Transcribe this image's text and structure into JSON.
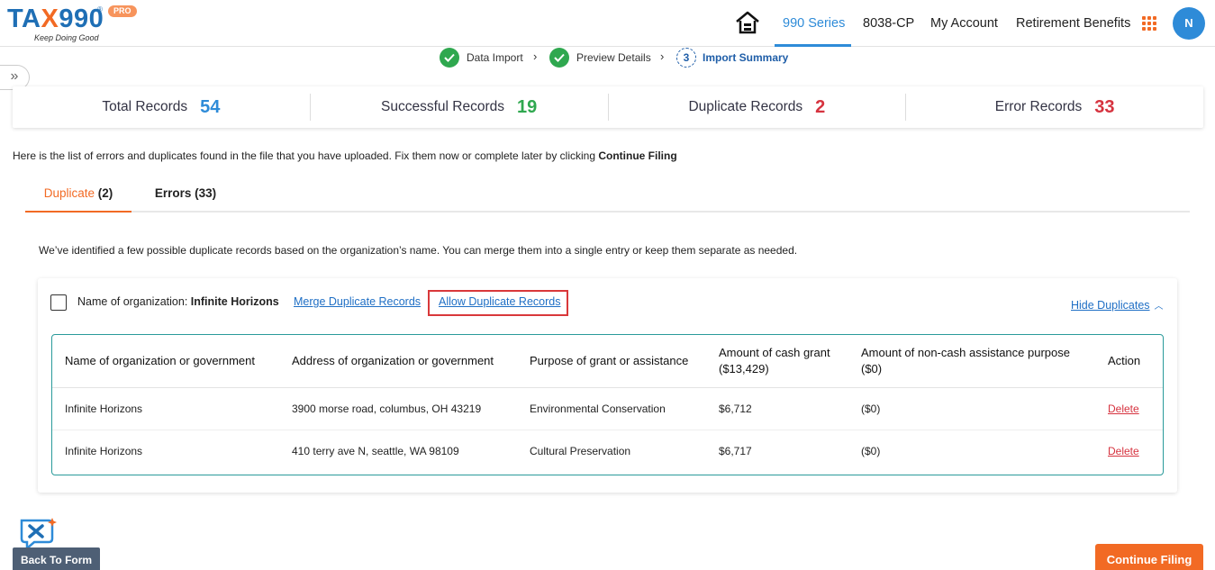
{
  "header": {
    "logo_tax": "TA",
    "logo_x": "X",
    "logo_num": "990",
    "logo_reg": "®",
    "logo_pro": "PRO",
    "logo_tagline": "Keep Doing Good",
    "nav": [
      {
        "label": "990 Series",
        "active": true
      },
      {
        "label": "8038-CP",
        "active": false
      },
      {
        "label": "My Account",
        "active": false
      },
      {
        "label": "Retirement Benefits",
        "active": false
      }
    ],
    "avatar_initial": "N",
    "accent_color": "#2e8bd8",
    "brand_orange": "#f26a24"
  },
  "stepper": {
    "steps": [
      {
        "label": "Data Import",
        "state": "done"
      },
      {
        "label": "Preview Details",
        "state": "done"
      },
      {
        "label": "Import Summary",
        "state": "current",
        "number": "3"
      }
    ]
  },
  "stats": [
    {
      "label": "Total Records",
      "value": "54",
      "color": "#2e8bd8"
    },
    {
      "label": "Successful Records",
      "value": "19",
      "color": "#2fa84f"
    },
    {
      "label": "Duplicate Records",
      "value": "2",
      "color": "#d6333f"
    },
    {
      "label": "Error Records",
      "value": "33",
      "color": "#d6333f"
    }
  ],
  "intro": {
    "text": "Here is the list of errors and duplicates found in the file that you have uploaded. Fix them now or complete later by clicking ",
    "bold": "Continue Filing"
  },
  "tabs": [
    {
      "label": "Duplicate",
      "count": "(2)",
      "active": true
    },
    {
      "label": "Errors (33)",
      "active": false
    }
  ],
  "duplicate_message": "We’ve identified a few possible duplicate records based on the organization’s name. You can merge them into a single entry or keep them separate as needed.",
  "group": {
    "org_label": "Name of organization:",
    "org_name": "Infinite Horizons",
    "merge_link": "Merge Duplicate Records",
    "allow_link": "Allow Duplicate Records",
    "hide_link": "Hide Duplicates",
    "columns": [
      "Name of organization or government",
      "Address of organization or government",
      "Purpose of grant or assistance",
      "Amount of cash grant",
      "Amount of non-cash assistance purpose",
      "Action"
    ],
    "column_subs": {
      "cash": "($13,429)",
      "noncash": "($0)"
    },
    "rows": [
      {
        "name": "Infinite Horizons",
        "address": "3900 morse road, columbus, OH 43219",
        "purpose": "Environmental Conservation",
        "cash": "$6,712",
        "noncash": "($0)",
        "action": "Delete"
      },
      {
        "name": "Infinite Horizons",
        "address": "410 terry ave N, seattle, WA 98109",
        "purpose": "Cultural Preservation",
        "cash": "$6,717",
        "noncash": "($0)",
        "action": "Delete"
      }
    ]
  },
  "footer": {
    "back_button": "Back To Form",
    "continue_button": "Continue Filing"
  }
}
